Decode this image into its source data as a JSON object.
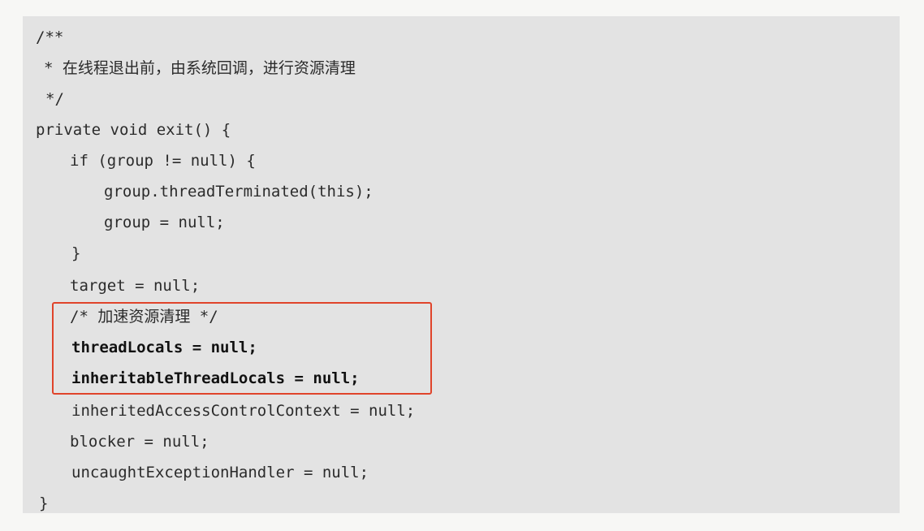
{
  "code": {
    "lines": [
      "/**",
      "* 在线程退出前，由系统回调，进行资源清理",
      "*/",
      "private void exit() {",
      "if (group != null) {",
      "group.threadTerminated(this);",
      "group = null;",
      "}",
      "target = null;",
      "/* 加速资源清理 */",
      "threadLocals = null;",
      "inheritableThreadLocals = null;",
      "inheritedAccessControlContext = null;",
      "blocker = null;",
      "uncaughtExceptionHandler = null;",
      "}"
    ],
    "highlight_color": "#e0442b"
  }
}
